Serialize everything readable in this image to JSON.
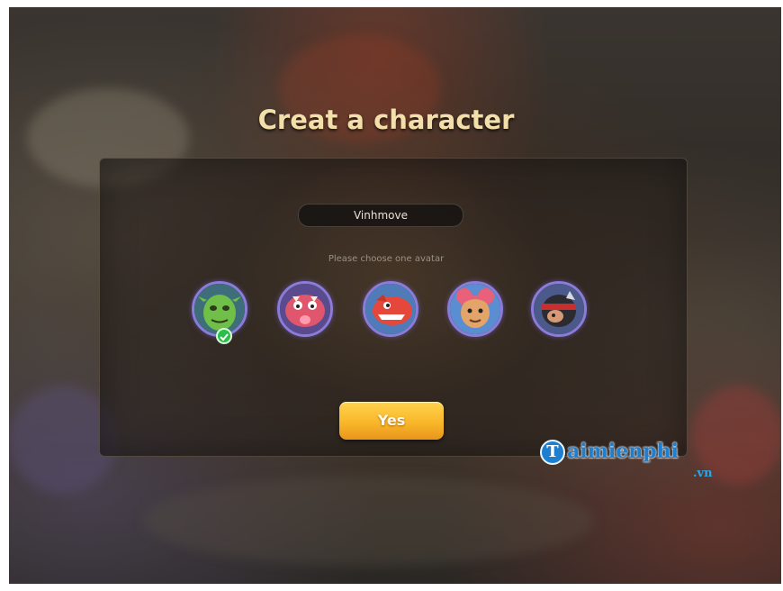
{
  "title": "Creat a character",
  "name_field": {
    "value": "Vinhmove"
  },
  "hint": "Please choose one avatar",
  "avatars": [
    {
      "icon": "green-goblin-avatar-icon",
      "selected": true
    },
    {
      "icon": "pink-monster-avatar-icon",
      "selected": false
    },
    {
      "icon": "red-dinosaur-avatar-icon",
      "selected": false
    },
    {
      "icon": "girl-avatar-icon",
      "selected": false
    },
    {
      "icon": "ninja-avatar-icon",
      "selected": false
    }
  ],
  "confirm_button": "Yes",
  "watermark": {
    "brand": "aimienphi",
    "letter": "T",
    "suffix": ".vn"
  },
  "colors": {
    "title": "#f3dfa9",
    "button": "#f9b72a",
    "avatar_ring": "#8a7cd8",
    "check": "#2bbf4a",
    "watermark": "#1e7fd0"
  }
}
